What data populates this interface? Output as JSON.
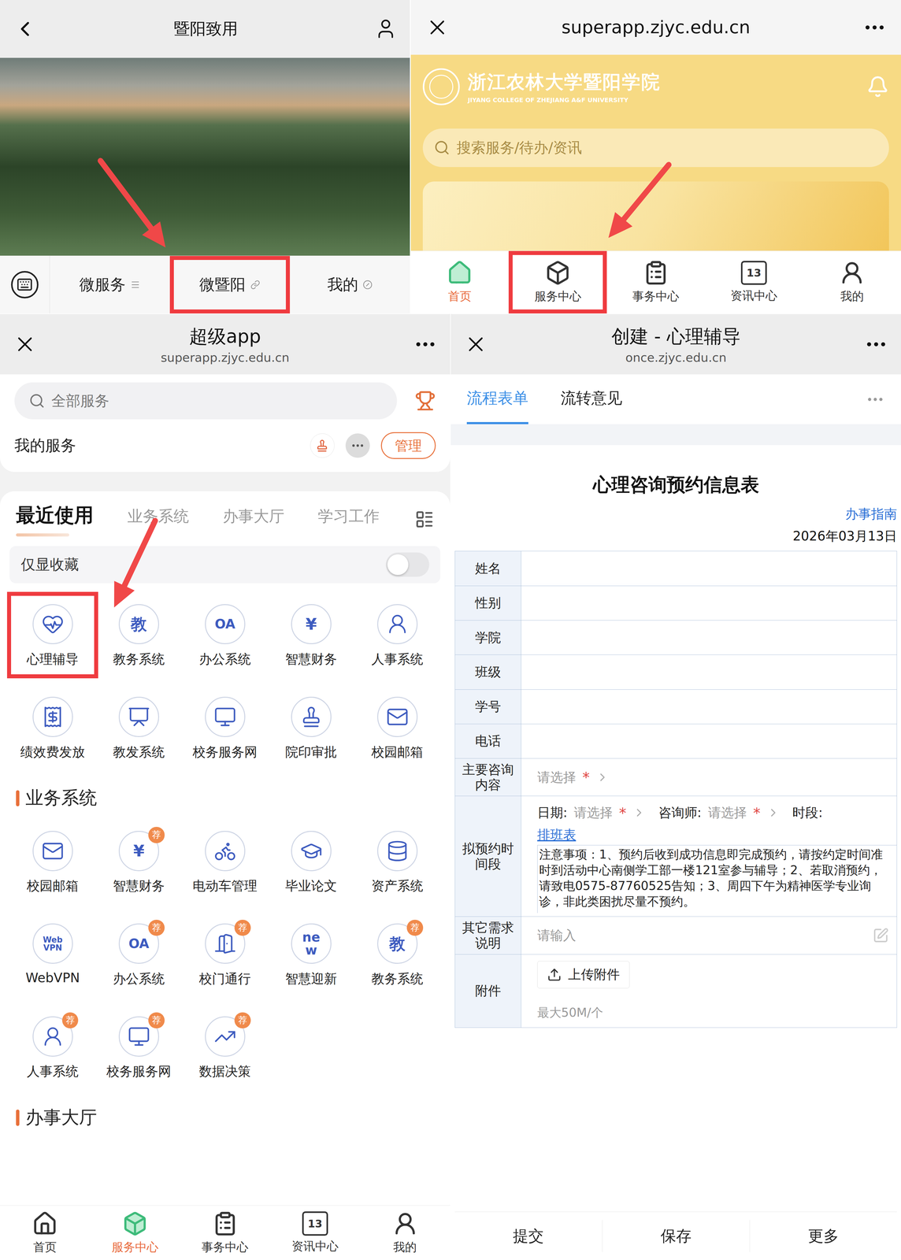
{
  "wechat": {
    "title": "暨阳致用",
    "menu": [
      {
        "label": "微服务",
        "highlighted": false
      },
      {
        "label": "微暨阳",
        "highlighted": true
      },
      {
        "label": "我的",
        "highlighted": false
      }
    ]
  },
  "portal": {
    "url": "superapp.zjyc.edu.cn",
    "school": {
      "name": "浙江农林大学暨阳学院",
      "name_en": "JIYANG COLLEGE OF ZHEJIANG A&F UNIVERSITY"
    },
    "search": {
      "placeholder": "搜索服务/待办/资讯"
    },
    "tabs": [
      {
        "label": "首页",
        "selected": true,
        "highlighted": false
      },
      {
        "label": "服务中心",
        "selected": false,
        "highlighted": true
      },
      {
        "label": "事务中心",
        "selected": false,
        "highlighted": false
      },
      {
        "label": "资讯中心",
        "glyph": "13",
        "selected": false,
        "highlighted": false
      },
      {
        "label": "我的",
        "selected": false,
        "highlighted": false
      }
    ]
  },
  "superapp": {
    "title": "超级app",
    "url": "superapp.zjyc.edu.cn",
    "search": {
      "placeholder": "全部服务"
    },
    "my_services": {
      "label": "我的服务",
      "manage": "管理"
    },
    "tabs": [
      {
        "label": "最近使用",
        "selected": true
      },
      {
        "label": "业务系统",
        "selected": false
      },
      {
        "label": "办事大厅",
        "selected": false
      },
      {
        "label": "学习工作",
        "selected": false
      }
    ],
    "favorites_only": {
      "label": "仅显收藏",
      "on": false
    },
    "recent": [
      {
        "label": "心理辅导",
        "highlighted": true
      },
      {
        "label": "教务系统",
        "glyph": "教",
        "highlighted": false
      },
      {
        "label": "办公系统",
        "glyph": "OA",
        "highlighted": false
      },
      {
        "label": "智慧财务",
        "glyph": "¥",
        "highlighted": false
      },
      {
        "label": "人事系统",
        "highlighted": false
      },
      {
        "label": "绩效费发放",
        "highlighted": false
      },
      {
        "label": "教发系统",
        "highlighted": false
      },
      {
        "label": "校务服务网",
        "highlighted": false
      },
      {
        "label": "院印审批",
        "highlighted": false
      },
      {
        "label": "校园邮箱",
        "highlighted": false
      }
    ],
    "sections": [
      {
        "title": "业务系统",
        "items": [
          {
            "label": "校园邮箱"
          },
          {
            "label": "智慧财务",
            "glyph": "¥",
            "badge": "荐"
          },
          {
            "label": "电动车管理"
          },
          {
            "label": "毕业论文"
          },
          {
            "label": "资产系统"
          },
          {
            "label": "WebVPN",
            "glyph": "Web VPN"
          },
          {
            "label": "办公系统",
            "glyph": "OA",
            "badge": "荐"
          },
          {
            "label": "校门通行",
            "badge": "荐"
          },
          {
            "label": "智慧迎新",
            "glyph": "new"
          },
          {
            "label": "教务系统",
            "glyph": "教",
            "badge": "荐"
          },
          {
            "label": "人事系统",
            "badge": "荐"
          },
          {
            "label": "校务服务网",
            "badge": "荐"
          },
          {
            "label": "数据决策",
            "badge": "荐"
          }
        ]
      },
      {
        "title": "办事大厅",
        "items": []
      }
    ],
    "tabbar": [
      {
        "label": "首页",
        "selected": false,
        "highlighted": false
      },
      {
        "label": "服务中心",
        "selected": true,
        "highlighted": false
      },
      {
        "label": "事务中心",
        "selected": false,
        "highlighted": false
      },
      {
        "label": "资讯中心",
        "glyph": "13",
        "selected": false,
        "highlighted": false
      },
      {
        "label": "我的",
        "selected": false,
        "highlighted": false
      }
    ]
  },
  "form_app": {
    "title": "创建 - 心理辅导",
    "url": "once.zjyc.edu.cn",
    "tabs": [
      {
        "label": "流程表单",
        "selected": true
      },
      {
        "label": "流转意见",
        "selected": false
      }
    ],
    "form": {
      "title": "心理咨询预约信息表",
      "guide": "办事指南",
      "date": "2026年03月13日",
      "rows": [
        {
          "kind": "text",
          "label": "姓名",
          "value": ""
        },
        {
          "kind": "text",
          "label": "性别",
          "value": ""
        },
        {
          "kind": "text",
          "label": "学院",
          "value": ""
        },
        {
          "kind": "text",
          "label": "班级",
          "value": ""
        },
        {
          "kind": "text",
          "label": "学号",
          "value": ""
        },
        {
          "kind": "text",
          "label": "电话",
          "value": ""
        },
        {
          "kind": "select",
          "label": "主要咨询内容",
          "placeholder": "请选择",
          "required_mark": "*"
        },
        {
          "kind": "schedule",
          "label": "拟预约时间段",
          "pickers": [
            {
              "label": "日期:",
              "placeholder": "请选择",
              "required_mark": "*"
            },
            {
              "label": "咨询师:",
              "placeholder": "请选择",
              "required_mark": "*"
            }
          ],
          "slot_label": "时段:",
          "schedule_link": "排班表",
          "note": "注意事项：1、预约后收到成功信息即完成预约，请按约定时间准时到活动中心南侧学工部一楼121室参与辅导；2、若取消预约，请致电0575-87760525告知；3、周四下午为精神医学专业询诊，非此类困扰尽量不预约。"
        },
        {
          "kind": "textarea",
          "label": "其它需求说明",
          "placeholder": "请输入"
        },
        {
          "kind": "attachment",
          "label": "附件",
          "button": "上传附件",
          "hint": "最大50M/个"
        }
      ]
    },
    "actions": [
      "提交",
      "保存",
      "更多"
    ]
  }
}
